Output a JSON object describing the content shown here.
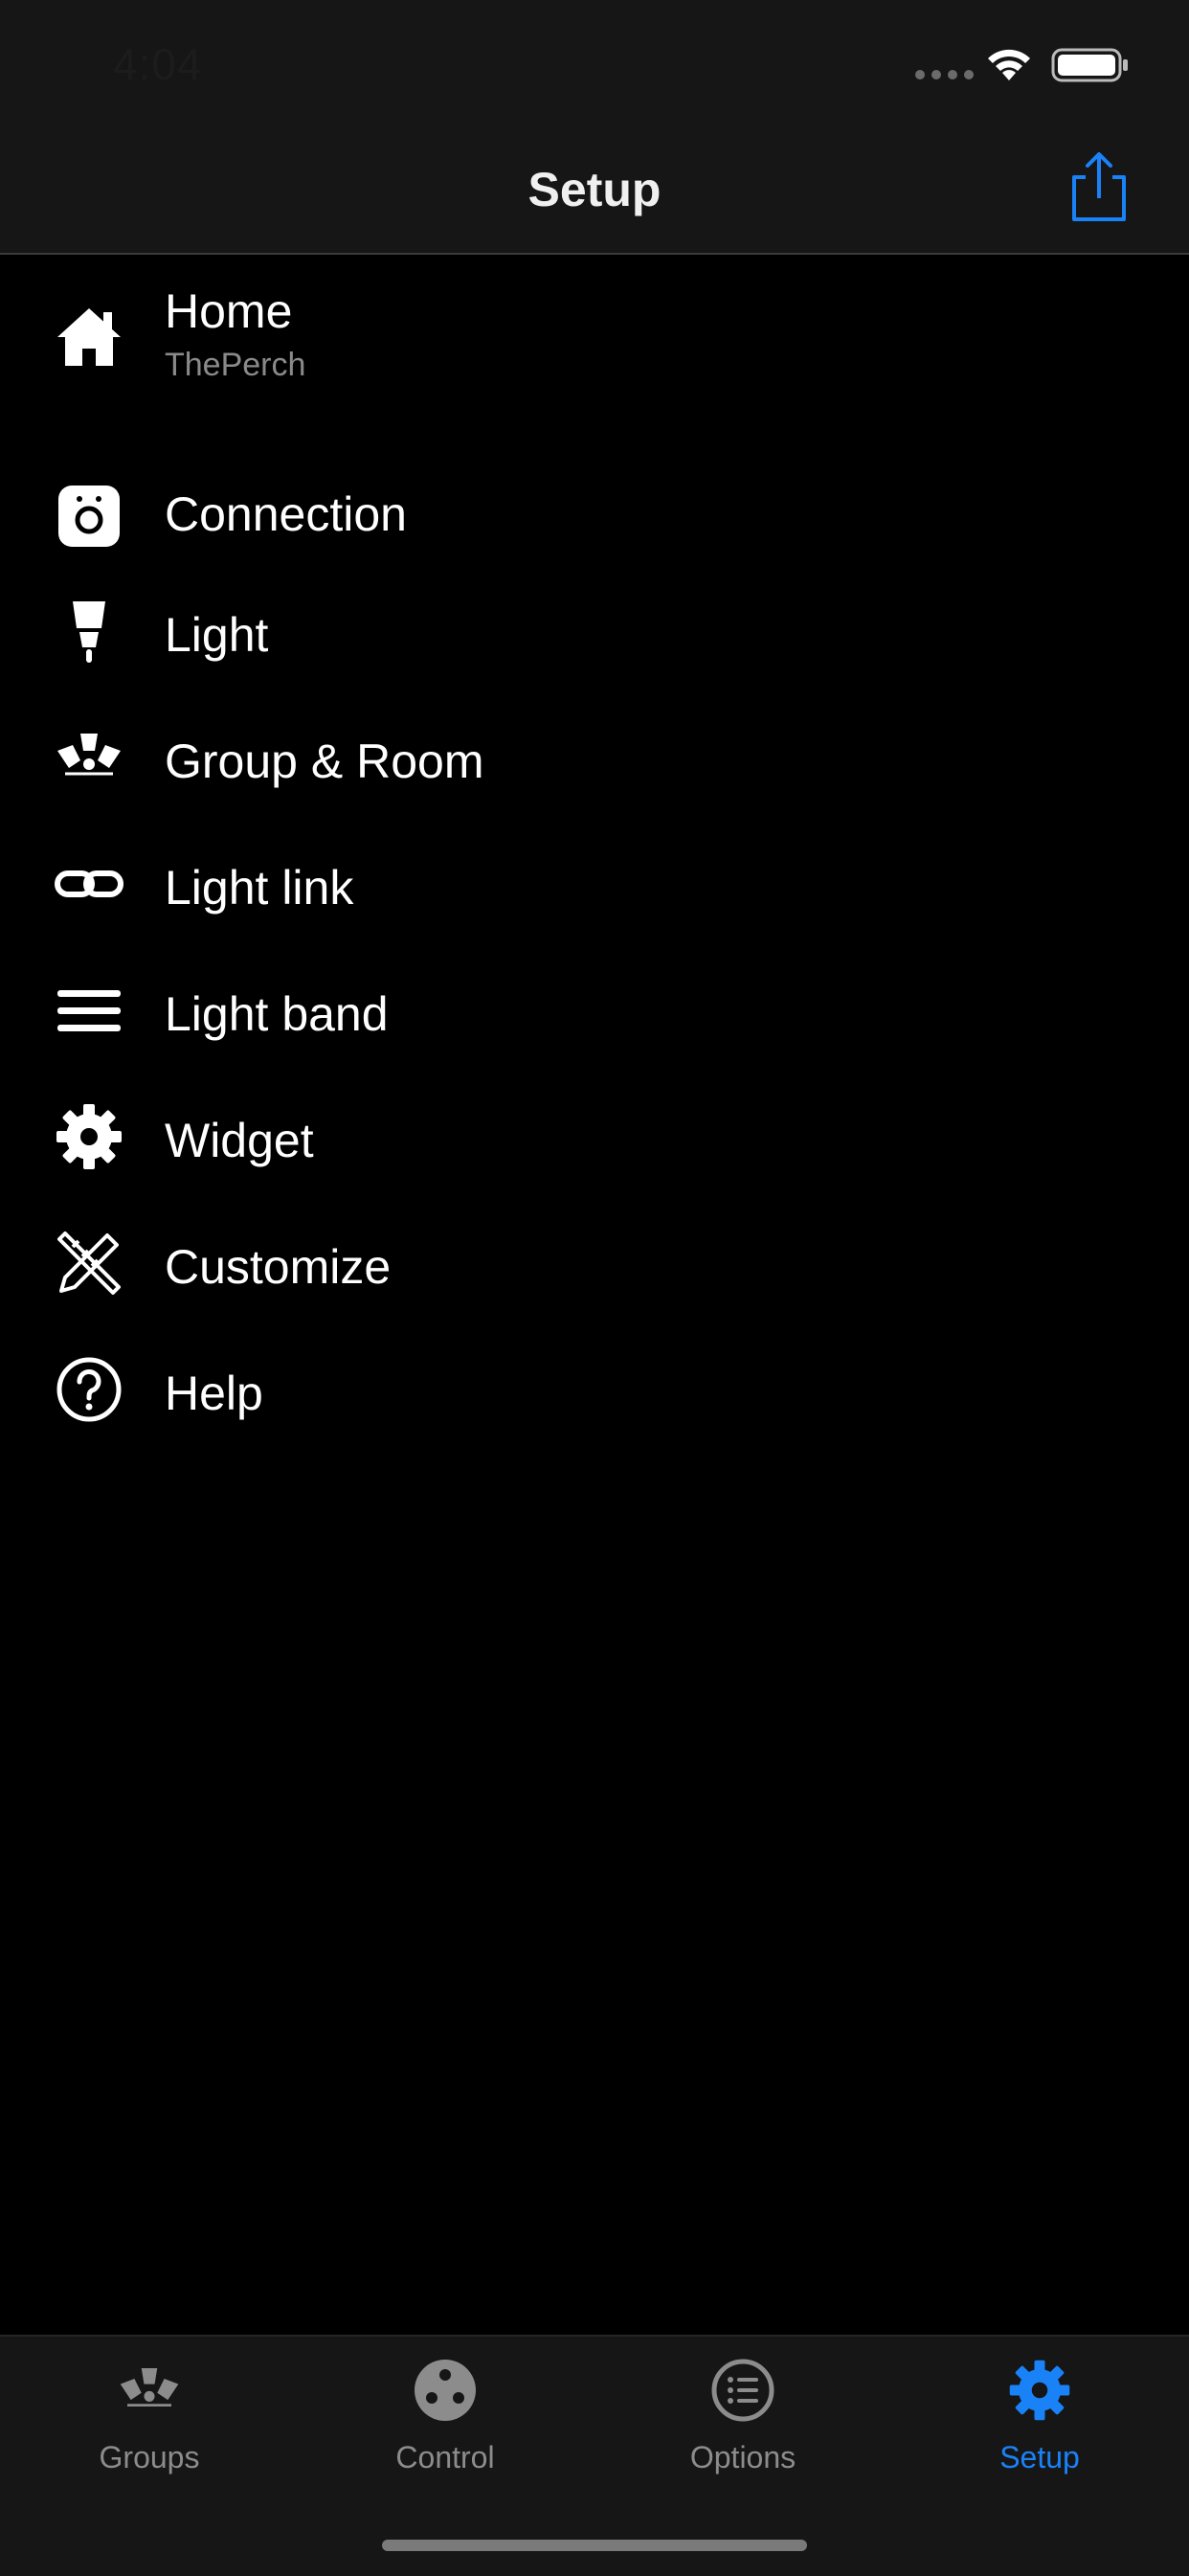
{
  "status_bar": {
    "time": "4:04"
  },
  "nav": {
    "title": "Setup",
    "share_icon": "share-icon"
  },
  "menu": [
    {
      "label": "Home",
      "subtitle": "ThePerch",
      "icon": "house-icon"
    },
    {
      "label": "Connection",
      "icon": "bridge-icon"
    },
    {
      "label": "Light",
      "icon": "bulb-icon"
    },
    {
      "label": "Group & Room",
      "icon": "group-lights-icon"
    },
    {
      "label": "Light link",
      "icon": "link-icon"
    },
    {
      "label": "Light band",
      "icon": "bars-icon"
    },
    {
      "label": "Widget",
      "icon": "gear-icon"
    },
    {
      "label": "Customize",
      "icon": "pencil-ruler-icon"
    },
    {
      "label": "Help",
      "icon": "question-circle-icon"
    }
  ],
  "tabs": [
    {
      "label": "Groups",
      "icon": "group-lights-icon",
      "active": false
    },
    {
      "label": "Control",
      "icon": "control-dial-icon",
      "active": false
    },
    {
      "label": "Options",
      "icon": "list-circle-icon",
      "active": false
    },
    {
      "label": "Setup",
      "icon": "gear-icon",
      "active": true
    }
  ],
  "colors": {
    "accent": "#1a82f7",
    "background": "#000000",
    "bar": "#161616",
    "inactive": "#8c8c8c"
  }
}
